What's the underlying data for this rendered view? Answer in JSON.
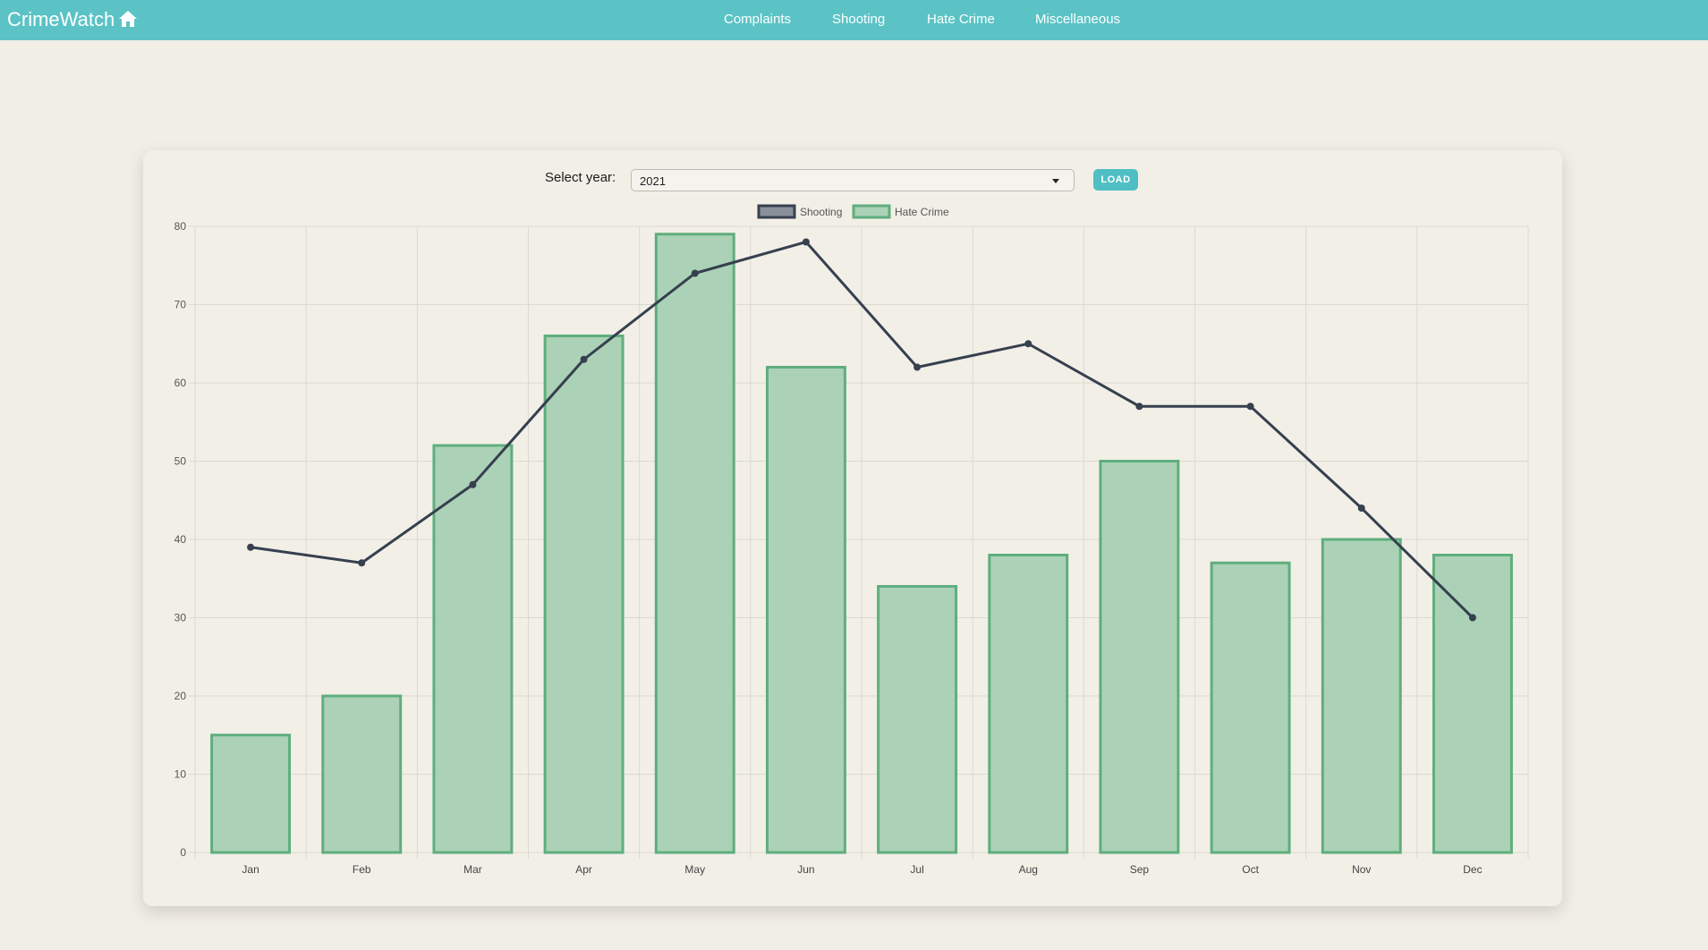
{
  "nav": {
    "brand": "CrimeWatch",
    "home_icon": "home-icon",
    "links": [
      "Complaints",
      "Shooting",
      "Hate Crime",
      "Miscellaneous"
    ]
  },
  "controls": {
    "year_label": "Select year:",
    "selected_year": "2021",
    "load_label": "LOAD"
  },
  "colors": {
    "navbar": "#5bc3c5",
    "shooting_line": "#36404f",
    "hate_fill": "#abd2b6",
    "hate_border": "#5fae7d"
  },
  "chart_data": {
    "type": "bar",
    "categories": [
      "Jan",
      "Feb",
      "Mar",
      "Apr",
      "May",
      "Jun",
      "Jul",
      "Aug",
      "Sep",
      "Oct",
      "Nov",
      "Dec"
    ],
    "series": [
      {
        "name": "Shooting",
        "type": "line",
        "values": [
          39,
          37,
          47,
          63,
          74,
          78,
          62,
          65,
          57,
          57,
          44,
          30
        ]
      },
      {
        "name": "Hate Crime",
        "type": "bar",
        "values": [
          15,
          20,
          52,
          66,
          79,
          62,
          34,
          38,
          50,
          37,
          40,
          38
        ]
      }
    ],
    "ylim": [
      0,
      80
    ],
    "yticks": [
      0,
      10,
      20,
      30,
      40,
      50,
      60,
      70,
      80
    ],
    "grid": true,
    "legend": "top"
  }
}
